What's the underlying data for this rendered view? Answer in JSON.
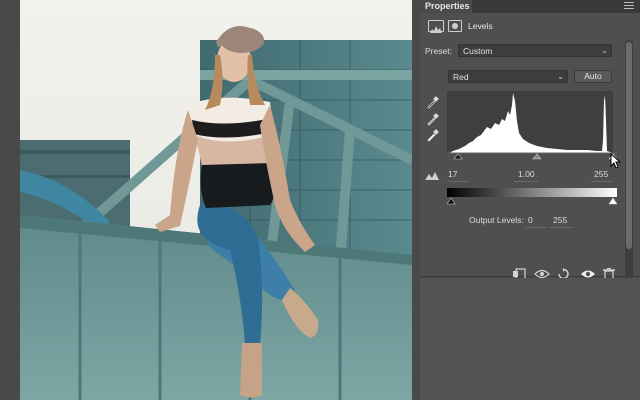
{
  "panel": {
    "tab_label": "Properties",
    "adjustment_title": "Levels",
    "preset_label": "Preset:",
    "preset_value": "Custom",
    "channel_value": "Red",
    "auto_label": "Auto",
    "input_black": "17",
    "input_gamma": "1.00",
    "input_white": "255",
    "output_label": "Output Levels:",
    "output_black": "0",
    "output_white": "255"
  },
  "icons": {
    "dropdown": "chevron-down-icon",
    "menu": "panel-menu-icon",
    "eyedroppers": [
      "black-point-eyedropper-icon",
      "gray-point-eyedropper-icon",
      "white-point-eyedropper-icon"
    ],
    "footer": [
      "clip-to-layer-icon",
      "view-previous-state-icon",
      "reset-icon",
      "visibility-eye-icon",
      "trash-icon"
    ]
  },
  "colors": {
    "panel_bg": "#4f4f4f",
    "histogram_fill": "#ffffff",
    "photo_tint": "#7fa8a8"
  }
}
